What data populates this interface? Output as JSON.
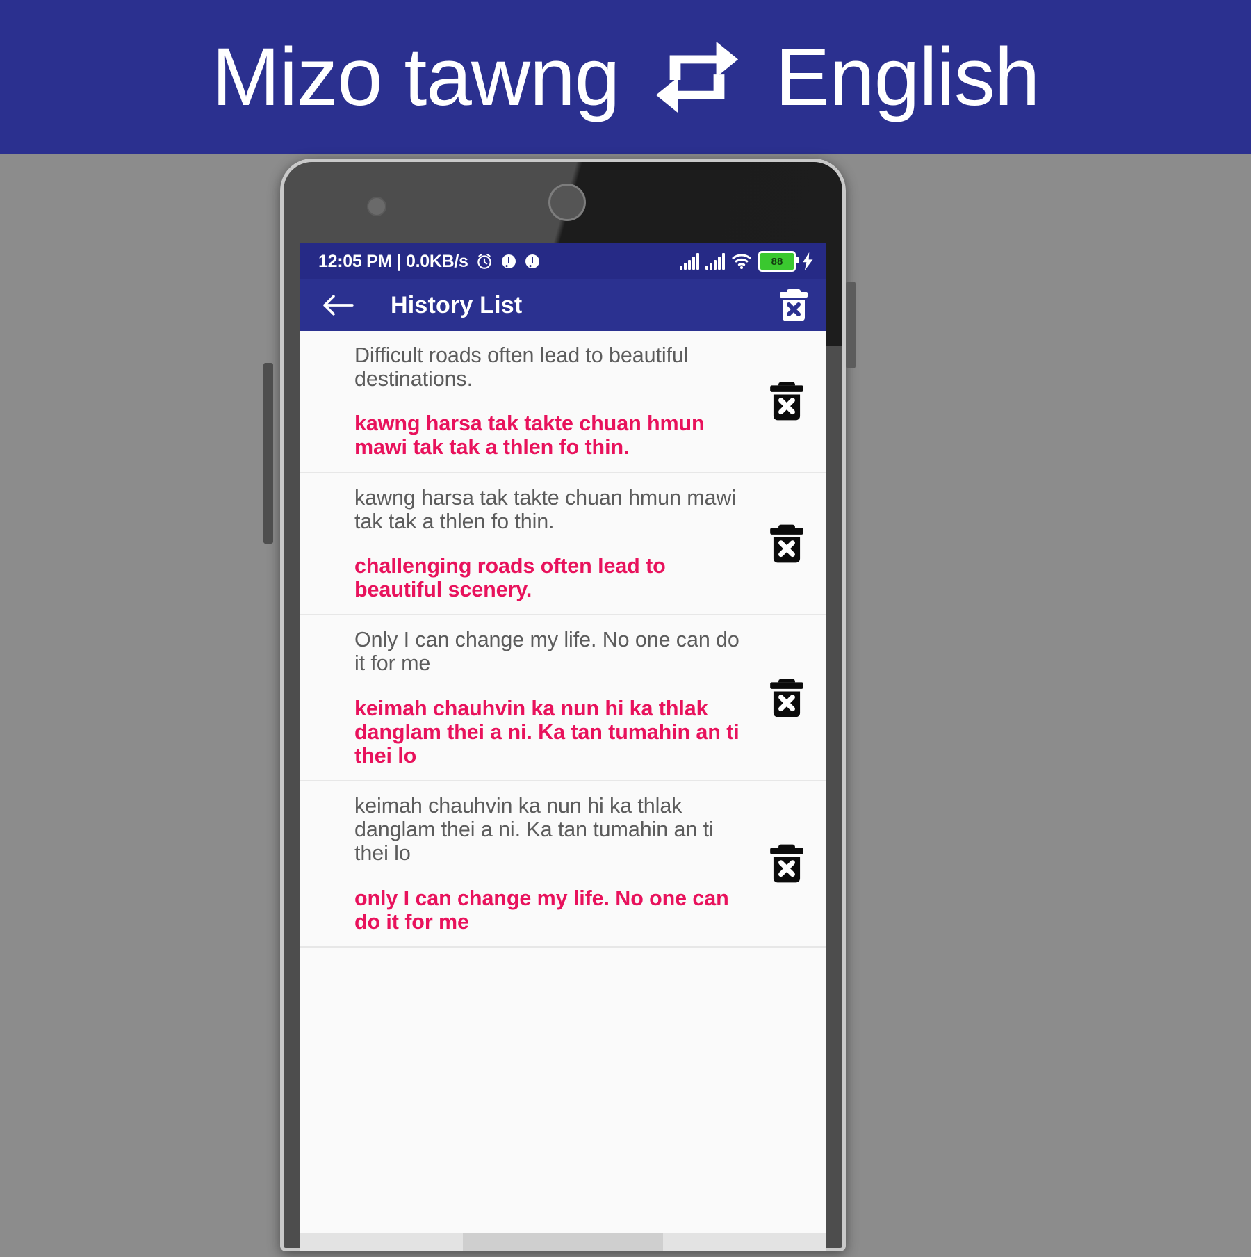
{
  "promo": {
    "source_language": "Mizo tawng",
    "target_language": "English",
    "swap_icon": "repeat-swap-icon"
  },
  "status_bar": {
    "clock_and_speed": "12:05 PM | 0.0KB/s",
    "icons": [
      "alarm-clock-icon",
      "dual-sim-1-icon",
      "dual-sim-2-icon"
    ],
    "signal_1": "signal-bars-icon",
    "signal_2": "signal-bars-icon",
    "wifi": "wifi-icon",
    "battery_level": "88",
    "charging": "charging-bolt-icon"
  },
  "app_bar": {
    "back_icon": "back-arrow-icon",
    "title": "History List",
    "clear_all_icon": "delete-all-icon"
  },
  "colors": {
    "brand_blue": "#2b3190",
    "status_blue": "#262a86",
    "accent_pink": "#e8125c",
    "source_text": "#5c5c5c",
    "battery_green": "#3ac82f"
  },
  "history": {
    "delete_icon": "delete-icon",
    "items": [
      {
        "source": "Difficult roads often lead to beautiful destinations.",
        "translation": "kawng harsa tak takte chuan hmun mawi tak tak a thlen fo thin."
      },
      {
        "source": "kawng harsa tak takte chuan hmun mawi tak tak a thlen fo thin.",
        "translation": "challenging roads often lead to beautiful scenery."
      },
      {
        "source": "Only I can change my life. No one can do it for me",
        "translation": "keimah chauhvin ka nun hi ka thlak danglam thei a ni. Ka tan tumahin an ti thei lo"
      },
      {
        "source": "keimah chauhvin ka nun hi ka thlak danglam thei a ni. Ka tan tumahin an ti thei lo",
        "translation": "only I can change my life. No one can do it for me"
      }
    ]
  }
}
